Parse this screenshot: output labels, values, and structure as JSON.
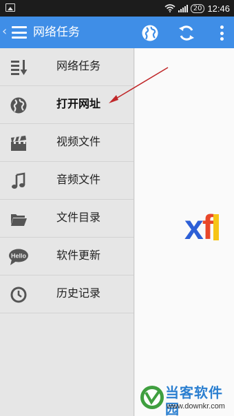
{
  "status_bar": {
    "battery": "20",
    "time": "12:46"
  },
  "app_bar": {
    "back_icon": "‹",
    "title": "网络任务",
    "menu_icon": "hamburger-icon",
    "actions": [
      "globe-icon",
      "refresh-icon",
      "more-vert-icon"
    ]
  },
  "menu": {
    "items": [
      {
        "label": "网络任务",
        "icon": "task-list-icon"
      },
      {
        "label": "打开网址",
        "icon": "globe-icon",
        "active": true
      },
      {
        "label": "视频文件",
        "icon": "clapperboard-icon"
      },
      {
        "label": "音频文件",
        "icon": "music-note-icon"
      },
      {
        "label": "文件目录",
        "icon": "folder-icon"
      },
      {
        "label": "软件更新",
        "icon": "hello-bubble-icon",
        "icon_text": "Hello"
      },
      {
        "label": "历史记录",
        "icon": "clock-icon"
      }
    ]
  },
  "content": {
    "logo_partial": {
      "x": "x",
      "f": "f"
    }
  },
  "watermark": {
    "title": "当客软件园",
    "url": "www.downkr.com"
  },
  "colors": {
    "app_bar": "#3f8ee7",
    "drawer_bg": "#e6e6e6",
    "annotation_arrow": "#c0282a"
  }
}
